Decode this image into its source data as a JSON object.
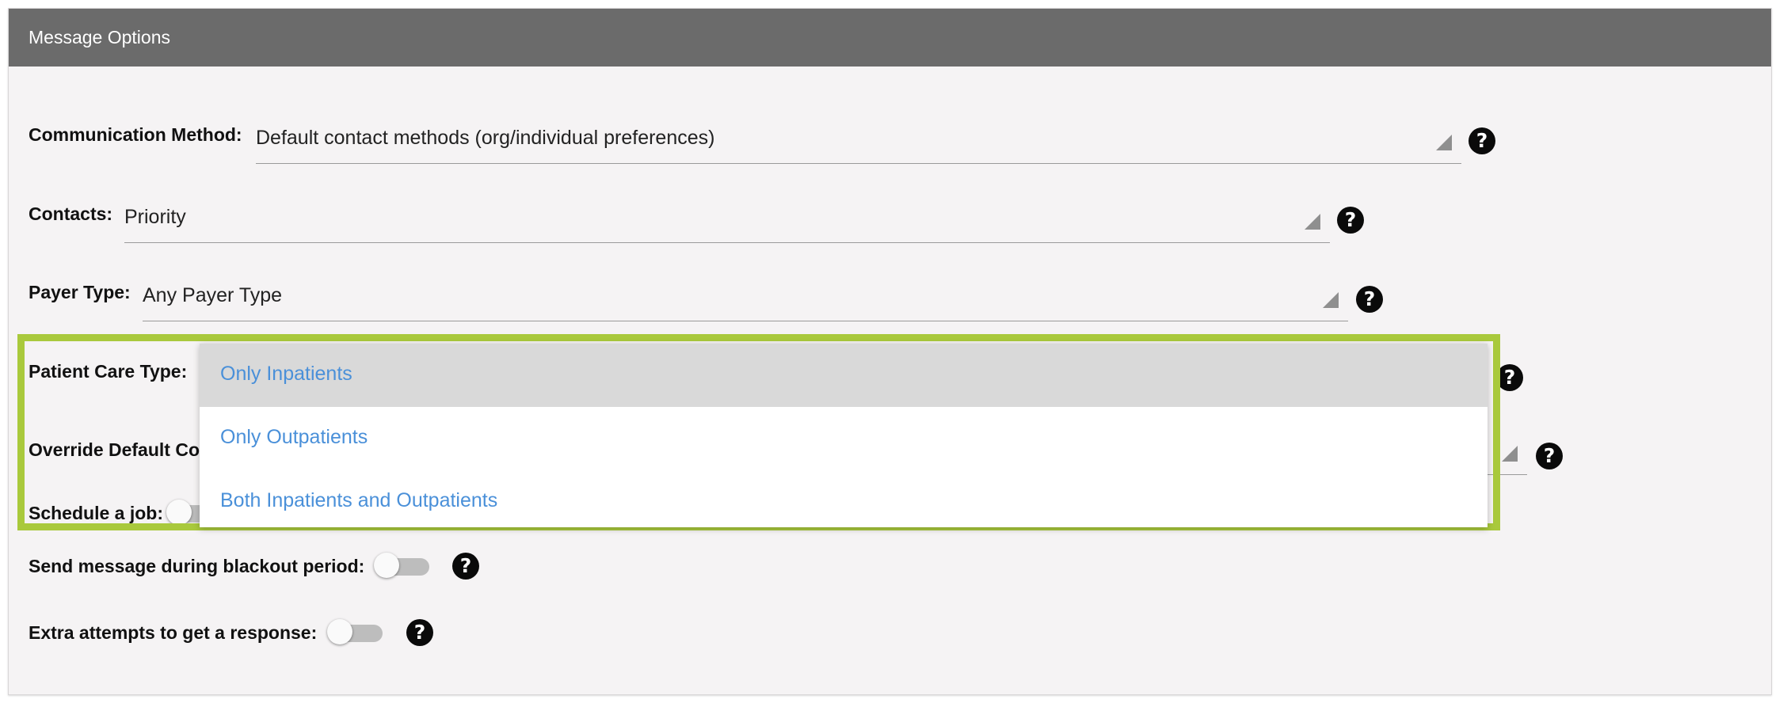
{
  "panel": {
    "title": "Message Options"
  },
  "fields": {
    "communication_method": {
      "label": "Communication Method:",
      "value": "Default contact methods (org/individual preferences)"
    },
    "contacts": {
      "label": "Contacts:",
      "value": "Priority"
    },
    "payer_type": {
      "label": "Payer Type:",
      "value": "Any Payer Type"
    },
    "patient_care_type": {
      "label": "Patient Care Type:"
    },
    "override_default": {
      "label_visible": "Override Default Co"
    },
    "schedule_job": {
      "label": "Schedule a job:",
      "enabled": false
    },
    "blackout": {
      "label": "Send message during blackout period:",
      "enabled": false
    },
    "extra_attempts": {
      "label": "Extra attempts to get a response:",
      "enabled": false
    }
  },
  "dropdown": {
    "options": [
      {
        "label": "Only Inpatients",
        "highlighted": true
      },
      {
        "label": "Only Outpatients",
        "highlighted": false
      },
      {
        "label": "Both Inpatients and Outpatients",
        "highlighted": false
      }
    ]
  },
  "icons": {
    "help": "?"
  },
  "colors": {
    "header_bg": "#6b6b6b",
    "panel_bg": "#f5f3f4",
    "highlight_border": "#a9c93c",
    "option_text": "#4a90d9",
    "option_selected_bg": "#d9d9d9"
  }
}
